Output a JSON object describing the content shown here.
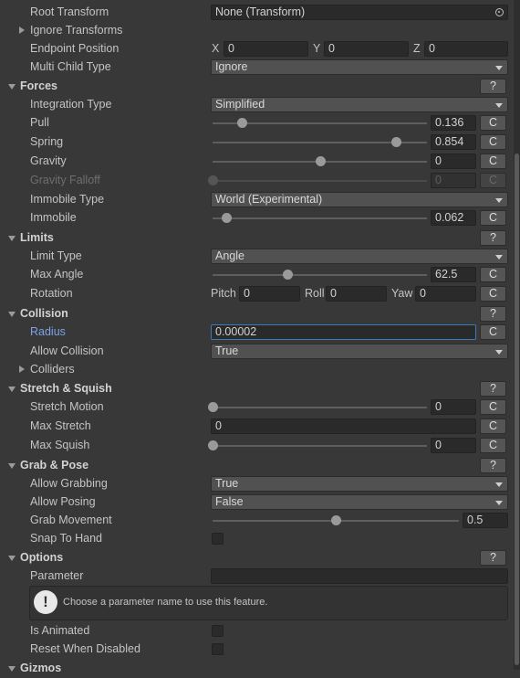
{
  "rows": {
    "root_transform": {
      "label": "Root Transform",
      "value": "None (Transform)"
    },
    "ignore_transforms": {
      "label": "Ignore Transforms"
    },
    "endpoint_position": {
      "label": "Endpoint Position",
      "x_label": "X",
      "x": "0",
      "y_label": "Y",
      "y": "0",
      "z_label": "Z",
      "z": "0"
    },
    "multi_child_type": {
      "label": "Multi Child Type",
      "value": "Ignore"
    }
  },
  "forces": {
    "title": "Forces",
    "help": "?",
    "integration_type": {
      "label": "Integration Type",
      "value": "Simplified"
    },
    "pull": {
      "label": "Pull",
      "value": "0.136",
      "level": 0.136
    },
    "spring": {
      "label": "Spring",
      "value": "0.854",
      "level": 0.854
    },
    "gravity": {
      "label": "Gravity",
      "value": "0",
      "level": 0.5
    },
    "gravity_falloff": {
      "label": "Gravity Falloff",
      "value": "0",
      "level": 0
    },
    "immobile_type": {
      "label": "Immobile Type",
      "value": "World (Experimental)"
    },
    "immobile": {
      "label": "Immobile",
      "value": "0.062",
      "level": 0.062
    }
  },
  "limits": {
    "title": "Limits",
    "help": "?",
    "limit_type": {
      "label": "Limit Type",
      "value": "Angle"
    },
    "max_angle": {
      "label": "Max Angle",
      "value": "62.5",
      "level": 0.347
    },
    "rotation": {
      "label": "Rotation",
      "pitch_label": "Pitch",
      "pitch": "0",
      "roll_label": "Roll",
      "roll": "0",
      "yaw_label": "Yaw",
      "yaw": "0"
    }
  },
  "collision": {
    "title": "Collision",
    "help": "?",
    "radius": {
      "label": "Radius",
      "value": "0.00002"
    },
    "allow_collision": {
      "label": "Allow Collision",
      "value": "True"
    },
    "colliders": {
      "label": "Colliders"
    }
  },
  "stretch": {
    "title": "Stretch & Squish",
    "help": "?",
    "stretch_motion": {
      "label": "Stretch Motion",
      "value": "0",
      "level": 0
    },
    "max_stretch": {
      "label": "Max Stretch",
      "value": "0"
    },
    "max_squish": {
      "label": "Max Squish",
      "value": "0",
      "level": 0
    }
  },
  "grab": {
    "title": "Grab & Pose",
    "help": "?",
    "allow_grabbing": {
      "label": "Allow Grabbing",
      "value": "True"
    },
    "allow_posing": {
      "label": "Allow Posing",
      "value": "False"
    },
    "grab_movement": {
      "label": "Grab Movement",
      "value": "0.5",
      "level": 0.5
    },
    "snap_to_hand": {
      "label": "Snap To Hand",
      "checked": false
    }
  },
  "options": {
    "title": "Options",
    "help": "?",
    "parameter": {
      "label": "Parameter",
      "value": ""
    },
    "help_text": "Choose a parameter name to use this feature.",
    "is_animated": {
      "label": "Is Animated",
      "checked": false
    },
    "reset_when_disabled": {
      "label": "Reset When Disabled",
      "checked": false
    }
  },
  "gizmos": {
    "title": "Gizmos"
  },
  "clear_label": "C",
  "colors": {
    "background": "#383838",
    "field": "#2a2a2a",
    "accent_focus": "#3a79bb",
    "label_focus": "#7ba2e6"
  }
}
